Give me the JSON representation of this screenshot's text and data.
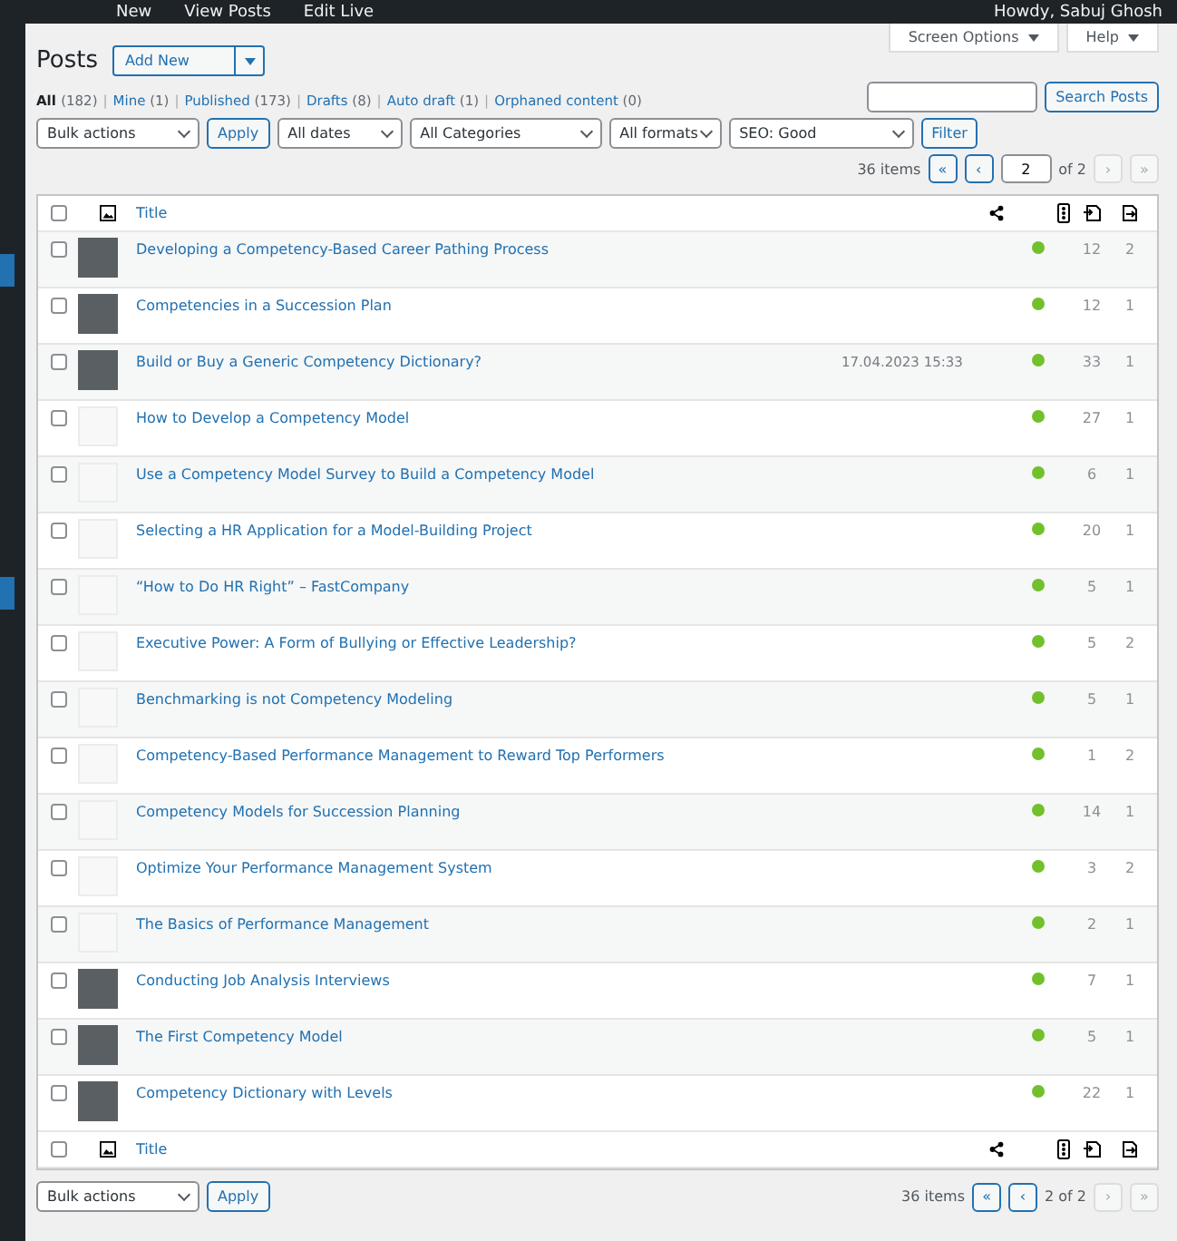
{
  "admin_bar": {
    "items": [
      "New",
      "View Posts",
      "Edit Live"
    ],
    "greeting": "Howdy, Sabuj Ghosh"
  },
  "top_buttons": [
    "Screen Options",
    "Help"
  ],
  "title": "Posts",
  "add_new": "Add New",
  "views": [
    {
      "label": "All",
      "count": "(182)",
      "selected": true
    },
    {
      "sep": "|",
      "label": "Mine",
      "count": "(1)",
      "selected": false
    },
    {
      "sep": "|",
      "label": "Published",
      "count": "(173)",
      "selected": false
    },
    {
      "sep": "|",
      "label": "Drafts",
      "count": "(8)",
      "selected": false
    },
    {
      "sep": "|",
      "label": "Auto draft",
      "count": "(1)",
      "selected": false
    },
    {
      "sep": "|",
      "label": "Orphaned content",
      "count": "(0)",
      "selected": false
    }
  ],
  "search": {
    "button": "Search Posts"
  },
  "filters": {
    "bulk": "Bulk actions",
    "apply": "Apply",
    "dates": "All dates",
    "categories": "All Categories",
    "formats": "All formats",
    "seo": "SEO: Good",
    "filter": "Filter"
  },
  "pagination": {
    "items": "36 items",
    "first": "«",
    "prev": "‹",
    "page": "2",
    "of": "of 2",
    "next": "›",
    "last": "»"
  },
  "columns": {
    "header": {
      "title": "Title",
      "checked": false
    },
    "footer": {
      "title": "Title",
      "checked": false
    }
  },
  "rows": [
    {
      "kind": "photo",
      "checked": false,
      "title": "Developing a Competency-Based Career Pathing Process",
      "color": "#72c02c",
      "c1": "12",
      "c2": "2"
    },
    {
      "kind": "photo",
      "checked": false,
      "title": "Competencies in a Succession Plan",
      "color": "#72c02c",
      "c1": "12",
      "c2": "1"
    },
    {
      "kind": "photo",
      "checked": false,
      "title": "Build or Buy a Generic Competency Dictionary?",
      "date": "17.04.2023 15:33",
      "color": "#72c02c",
      "c1": "33",
      "c2": "1"
    },
    {
      "kind": "blank",
      "checked": false,
      "title": "How to Develop a Competency Model",
      "color": "#72c02c",
      "c1": "27",
      "c2": "1"
    },
    {
      "kind": "blank",
      "checked": false,
      "title": "Use a Competency Model Survey to Build a Competency Model",
      "color": "#72c02c",
      "c1": "6",
      "c2": "1"
    },
    {
      "kind": "blank",
      "checked": false,
      "title": "Selecting a HR Application for a Model-Building Project",
      "color": "#72c02c",
      "c1": "20",
      "c2": "1"
    },
    {
      "kind": "blank",
      "checked": false,
      "title": "“How to Do HR Right” – FastCompany",
      "color": "#72c02c",
      "c1": "5",
      "c2": "1"
    },
    {
      "kind": "blank",
      "checked": false,
      "title": "Executive Power: A Form of Bullying or Effective Leadership?",
      "color": "#72c02c",
      "c1": "5",
      "c2": "2"
    },
    {
      "kind": "blank",
      "checked": false,
      "title": "Benchmarking is not Competency Modeling",
      "color": "#72c02c",
      "c1": "5",
      "c2": "1"
    },
    {
      "kind": "blank",
      "checked": false,
      "title": "Competency-Based Performance Management to Reward Top Performers",
      "color": "#72c02c",
      "c1": "1",
      "c2": "2"
    },
    {
      "kind": "blank",
      "checked": false,
      "title": "Competency Models for Succession Planning",
      "color": "#72c02c",
      "c1": "14",
      "c2": "1"
    },
    {
      "kind": "blank",
      "checked": false,
      "title": "Optimize Your Performance Management System",
      "color": "#72c02c",
      "c1": "3",
      "c2": "2"
    },
    {
      "kind": "blank",
      "checked": false,
      "title": "The Basics of Performance Management",
      "color": "#72c02c",
      "c1": "2",
      "c2": "1"
    },
    {
      "kind": "photo",
      "checked": false,
      "title": "Conducting Job Analysis Interviews",
      "color": "#72c02c",
      "c1": "7",
      "c2": "1"
    },
    {
      "kind": "photo",
      "checked": false,
      "title": "The First Competency Model",
      "color": "#72c02c",
      "c1": "5",
      "c2": "1"
    },
    {
      "kind": "photo",
      "checked": false,
      "title": "Competency Dictionary with Levels",
      "color": "#72c02c",
      "c1": "22",
      "c2": "1"
    }
  ],
  "bottom": {
    "bulk": "Bulk actions",
    "apply": "Apply",
    "items": "36 items",
    "first": "«",
    "prev": "‹",
    "page_text": "2 of 2",
    "next": "›",
    "last": "»"
  }
}
